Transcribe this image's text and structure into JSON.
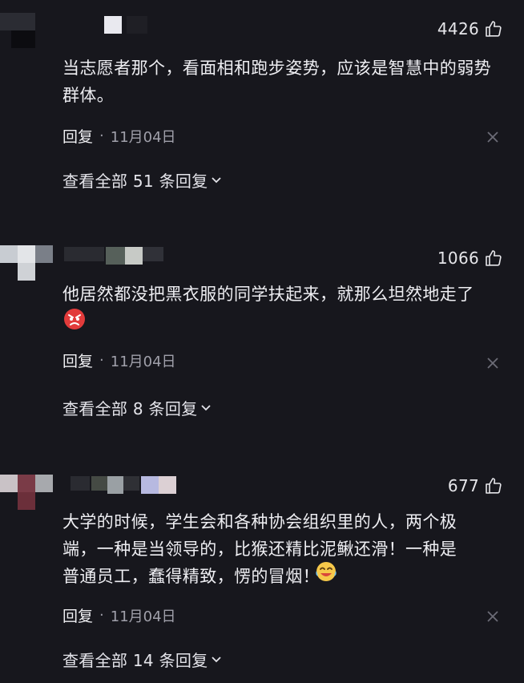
{
  "comments": [
    {
      "likes": "4426",
      "text": "当志愿者那个，看面相和跑步姿势，应该是智慧中的弱势群体。",
      "reply_label": "回复",
      "separator": "·",
      "date": "11月04日",
      "view_replies": "查看全部 51 条回复"
    },
    {
      "likes": "1066",
      "text": "他居然都没把黑衣服的同学扶起来，就那么坦然地走了",
      "emoji": "angry-face-emoji",
      "reply_label": "回复",
      "separator": "·",
      "date": "11月04日",
      "view_replies": "查看全部 8 条回复"
    },
    {
      "likes": "677",
      "text": "大学的时候，学生会和各种协会组织里的人，两个极端，一种是当领导的，比猴还精比泥鳅还滑！一种是普通员工，蠢得精致，愣的冒烟！",
      "emoji": "laughing-tears-emoji",
      "reply_label": "回复",
      "separator": "·",
      "date": "11月04日",
      "view_replies": "查看全部 14 条回复"
    }
  ],
  "icons": {
    "like": "thumbs-up-icon",
    "close": "close-icon",
    "expand": "chevron-down-icon"
  }
}
